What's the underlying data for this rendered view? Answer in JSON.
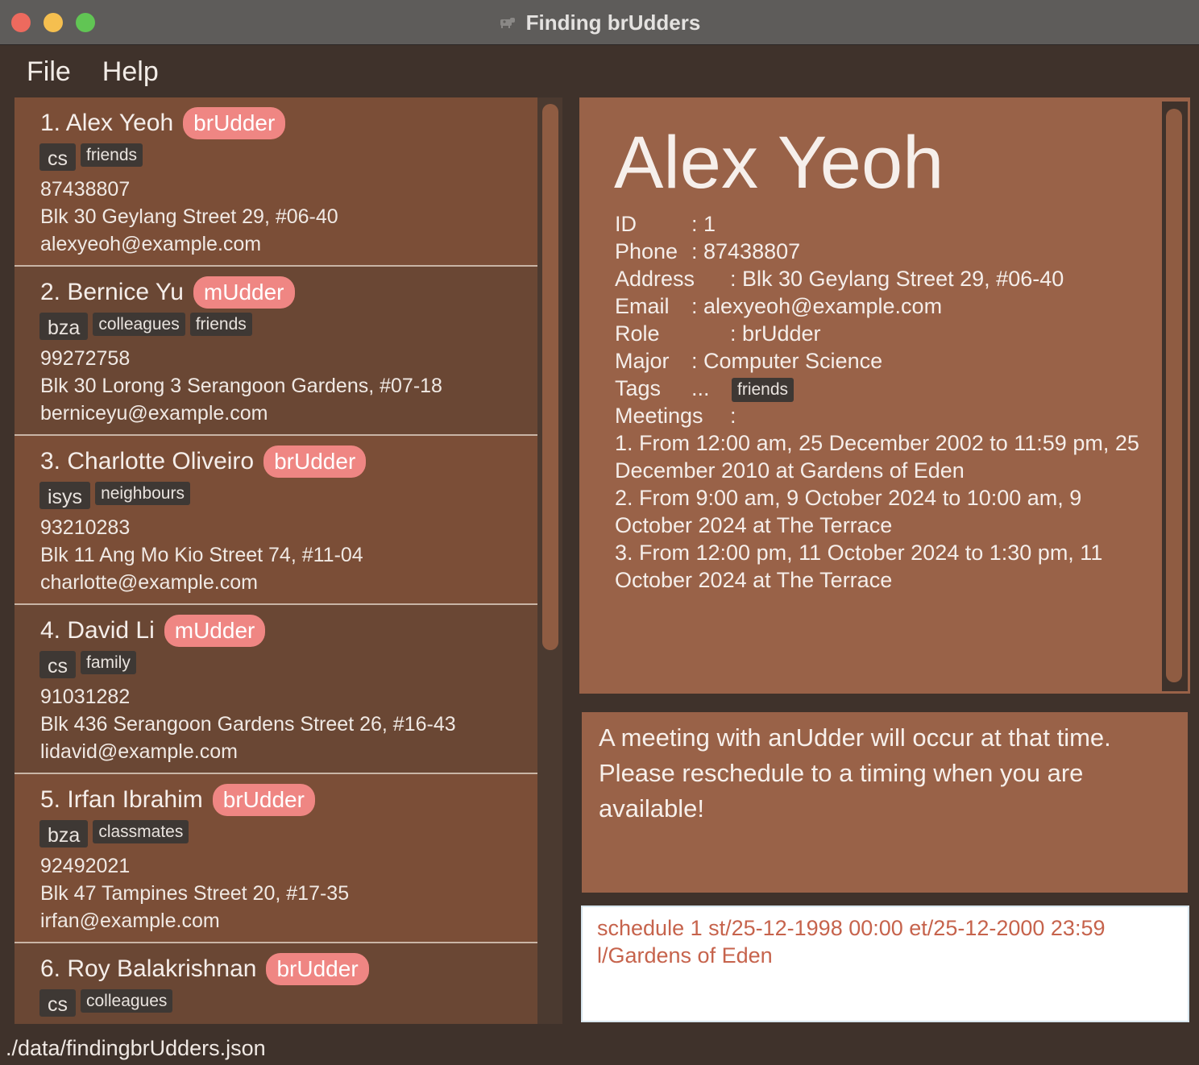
{
  "window": {
    "title": "Finding brUdders"
  },
  "menu": {
    "file": "File",
    "help": "Help"
  },
  "persons": [
    {
      "index_name": "1. Alex Yeoh",
      "role": "brUdder",
      "major": "cs",
      "tags": [
        "friends"
      ],
      "phone": "87438807",
      "address": "Blk 30 Geylang Street 29, #06-40",
      "email": "alexyeoh@example.com"
    },
    {
      "index_name": "2. Bernice Yu",
      "role": "mUdder",
      "major": "bza",
      "tags": [
        "colleagues",
        "friends"
      ],
      "phone": "99272758",
      "address": "Blk 30 Lorong 3 Serangoon Gardens, #07-18",
      "email": "berniceyu@example.com"
    },
    {
      "index_name": "3. Charlotte Oliveiro",
      "role": "brUdder",
      "major": "isys",
      "tags": [
        "neighbours"
      ],
      "phone": "93210283",
      "address": "Blk 11 Ang Mo Kio Street 74, #11-04",
      "email": "charlotte@example.com"
    },
    {
      "index_name": "4. David Li",
      "role": "mUdder",
      "major": "cs",
      "tags": [
        "family"
      ],
      "phone": "91031282",
      "address": "Blk 436 Serangoon Gardens Street 26, #16-43",
      "email": "lidavid@example.com"
    },
    {
      "index_name": "5. Irfan Ibrahim",
      "role": "brUdder",
      "major": "bza",
      "tags": [
        "classmates"
      ],
      "phone": "92492021",
      "address": "Blk 47 Tampines Street 20, #17-35",
      "email": "irfan@example.com"
    },
    {
      "index_name": "6. Roy Balakrishnan",
      "role": "brUdder",
      "major": "cs",
      "tags": [
        "colleagues"
      ],
      "phone": "",
      "address": "",
      "email": ""
    }
  ],
  "detail": {
    "name": "Alex Yeoh",
    "id_label": "ID",
    "id_value": ": 1",
    "phone_label": "Phone",
    "phone_value": ": 87438807",
    "address_label": "Address",
    "address_value": ": Blk 30 Geylang Street 29, #06-40",
    "email_label": "Email",
    "email_value": ": alexyeoh@example.com",
    "role_label": "Role",
    "role_value": ": brUdder",
    "major_label": "Major",
    "major_value": ": Computer Science",
    "tags_label": "Tags",
    "tags_sep": "...",
    "tag": "friends",
    "meetings_label": "Meetings",
    "meetings_sep": ":",
    "meetings": [
      "1. From 12:00 am, 25 December 2002 to 11:59 pm, 25 December 2010 at Gardens of Eden",
      "2. From 9:00 am, 9 October 2024 to 10:00 am, 9 October 2024 at The Terrace",
      "3. From 12:00 pm, 11 October 2024 to 1:30 pm, 11 October 2024 at The Terrace"
    ]
  },
  "result": {
    "message": "A meeting with anUdder will occur at that time. Please reschedule to a timing when you are available!"
  },
  "command": {
    "value": "schedule 1 st/25-12-1998 00:00 et/25-12-2000 23:59 l/Gardens of Eden"
  },
  "status": {
    "file_path": "./data/findingbrUdders.json"
  },
  "colors": {
    "background": "#3f322b",
    "card_odd": "#7b4e37",
    "card_even": "#6a4734",
    "detail_panel": "#996248",
    "role_badge": "#ef8683",
    "tag": "#3e3834",
    "command_text_error": "#c6634c"
  },
  "icons": {
    "app": "cow-icon"
  }
}
